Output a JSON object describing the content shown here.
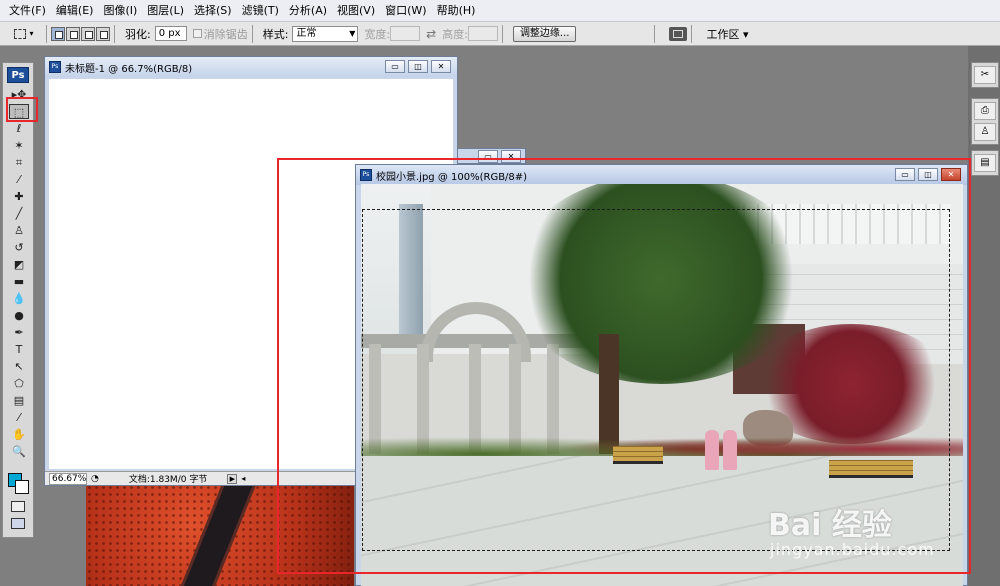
{
  "menubar": {
    "items": [
      "文件(F)",
      "编辑(E)",
      "图像(I)",
      "图层(L)",
      "选择(S)",
      "滤镜(T)",
      "分析(A)",
      "视图(V)",
      "窗口(W)",
      "帮助(H)"
    ]
  },
  "options": {
    "feather_label": "羽化:",
    "feather_value": "0 px",
    "antialias_label": "消除锯齿",
    "style_label": "样式:",
    "style_value": "正常",
    "width_label": "宽度:",
    "height_label": "高度:",
    "refine_button": "调整边缘...",
    "workspace_label": "工作区 ▾"
  },
  "toolbox": {
    "logo": "Ps",
    "tools": [
      {
        "name": "move-tool",
        "glyph": "▸✥"
      },
      {
        "name": "rect-marquee-tool",
        "glyph": "⬚"
      },
      {
        "name": "lasso-tool",
        "glyph": "ℓ"
      },
      {
        "name": "magic-wand-tool",
        "glyph": "✶"
      },
      {
        "name": "crop-tool",
        "glyph": "⌗"
      },
      {
        "name": "eyedropper-tool",
        "glyph": "⁄"
      },
      {
        "name": "healing-brush-tool",
        "glyph": "✚"
      },
      {
        "name": "brush-tool",
        "glyph": "╱"
      },
      {
        "name": "clone-stamp-tool",
        "glyph": "♙"
      },
      {
        "name": "history-brush-tool",
        "glyph": "↺"
      },
      {
        "name": "eraser-tool",
        "glyph": "◩"
      },
      {
        "name": "gradient-tool",
        "glyph": "▬"
      },
      {
        "name": "blur-tool",
        "glyph": "💧"
      },
      {
        "name": "dodge-tool",
        "glyph": "●"
      },
      {
        "name": "pen-tool",
        "glyph": "✒"
      },
      {
        "name": "type-tool",
        "glyph": "T"
      },
      {
        "name": "path-selection-tool",
        "glyph": "↖"
      },
      {
        "name": "shape-tool",
        "glyph": "⬠"
      },
      {
        "name": "notes-tool",
        "glyph": "▤"
      },
      {
        "name": "eyedropper2-tool",
        "glyph": "⁄"
      },
      {
        "name": "hand-tool",
        "glyph": "✋"
      },
      {
        "name": "zoom-tool",
        "glyph": "🔍"
      }
    ]
  },
  "doc1": {
    "title": "未标题-1 @ 66.7%(RGB/8)",
    "zoom": "66.67%",
    "status": "文档:1.83M/0 字节"
  },
  "doc2": {
    "title": "校园小景.jpg @ 100%(RGB/8#)"
  },
  "watermark": {
    "main": "Bai 经验",
    "sub": "jingyan.baidu.com"
  },
  "colors": {
    "foreground": "#00a8d6",
    "background": "#ffffff",
    "annotation": "#e8262b"
  }
}
